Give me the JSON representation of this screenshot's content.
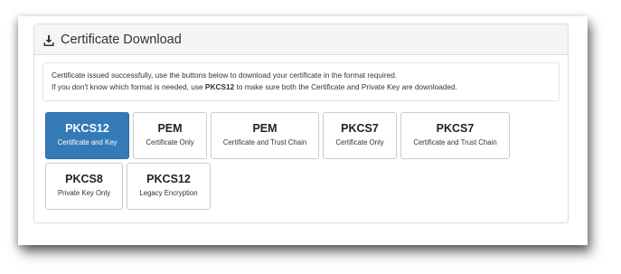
{
  "panel": {
    "title": "Certificate Download",
    "icon": "download-icon"
  },
  "info": {
    "line1": "Certificate issued successfully, use the buttons below to download your certificate in the format required.",
    "line2_pre": "If you don't know which format is needed, use ",
    "line2_bold": "PKCS12",
    "line2_post": " to make sure both the Certificate and Private Key are downloaded."
  },
  "formats": [
    {
      "name": "PKCS12",
      "desc": "Certificate and Key",
      "active": true
    },
    {
      "name": "PEM",
      "desc": "Certificate Only",
      "active": false
    },
    {
      "name": "PEM",
      "desc": "Certificate and Trust Chain",
      "active": false
    },
    {
      "name": "PKCS7",
      "desc": "Certificate Only",
      "active": false
    },
    {
      "name": "PKCS7",
      "desc": "Certificate and Trust Chain",
      "active": false
    },
    {
      "name": "PKCS8",
      "desc": "Private Key Only",
      "active": false
    },
    {
      "name": "PKCS12",
      "desc": "Legacy Encryption",
      "active": false
    }
  ],
  "colors": {
    "active_button": "#337ab7",
    "heading_bg": "#f5f5f5"
  }
}
